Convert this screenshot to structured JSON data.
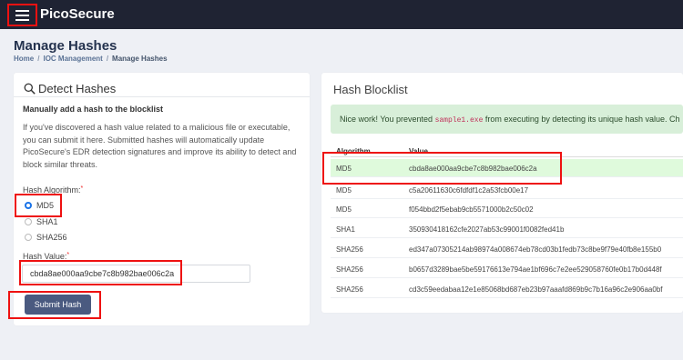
{
  "app": {
    "brand": "PicoSecure"
  },
  "page": {
    "title": "Manage Hashes",
    "breadcrumb": [
      "Home",
      "IOC Management",
      "Manage Hashes"
    ],
    "breadcrumb_sep": "/"
  },
  "detect": {
    "title": "Detect Hashes",
    "subheading": "Manually add a hash to the blocklist",
    "description": "If you've discovered a hash value related to a malicious file or executable, you can submit it here. Submitted hashes will automatically update PicoSecure's EDR detection signatures and improve its ability to detect and block similar threats.",
    "algorithm_label": "Hash Algorithm:",
    "required_mark": "*",
    "algorithms": [
      {
        "label": "MD5",
        "selected": true
      },
      {
        "label": "SHA1",
        "selected": false
      },
      {
        "label": "SHA256",
        "selected": false
      }
    ],
    "hash_label": "Hash Value:",
    "hash_value": "cbda8ae000aa9cbe7c8b982bae006c2a",
    "submit_label": "Submit Hash"
  },
  "blocklist": {
    "title": "Hash Blocklist",
    "alert": {
      "prefix": "Nice work! You prevented ",
      "file": "sample1.exe",
      "suffix": " from executing by detecting its unique hash value. Ch"
    },
    "columns": [
      "Algorithm",
      "Value"
    ],
    "rows": [
      {
        "algorithm": "MD5",
        "value": "cbda8ae000aa9cbe7c8b982bae006c2a",
        "highlighted": true
      },
      {
        "algorithm": "MD5",
        "value": "c5a20611630c6fdfdf1c2a53fcb00e17",
        "highlighted": false
      },
      {
        "algorithm": "MD5",
        "value": "f054bbd2f5ebab9cb5571000b2c50c02",
        "highlighted": false
      },
      {
        "algorithm": "SHA1",
        "value": "350930418162cfe2027ab53c99001f0082fed41b",
        "highlighted": false
      },
      {
        "algorithm": "SHA256",
        "value": "ed347a07305214ab98974a008674eb78cd03b1fedb73c8be9f79e40fb8e155b0",
        "highlighted": false
      },
      {
        "algorithm": "SHA256",
        "value": "b0657d3289bae5be59176613e794ae1bf696c7e2ee529058760fe0b17b0d448f",
        "highlighted": false
      },
      {
        "algorithm": "SHA256",
        "value": "cd3c59eedabaa12e1e85068bd687eb23b97aaafd869b9c7b16a96c2e906aa0bf",
        "highlighted": false
      }
    ]
  },
  "colors": {
    "topbar": "#1f2333",
    "accent": "#4a5a80",
    "highlight": "#dffadc",
    "annotation": "#e11111"
  }
}
